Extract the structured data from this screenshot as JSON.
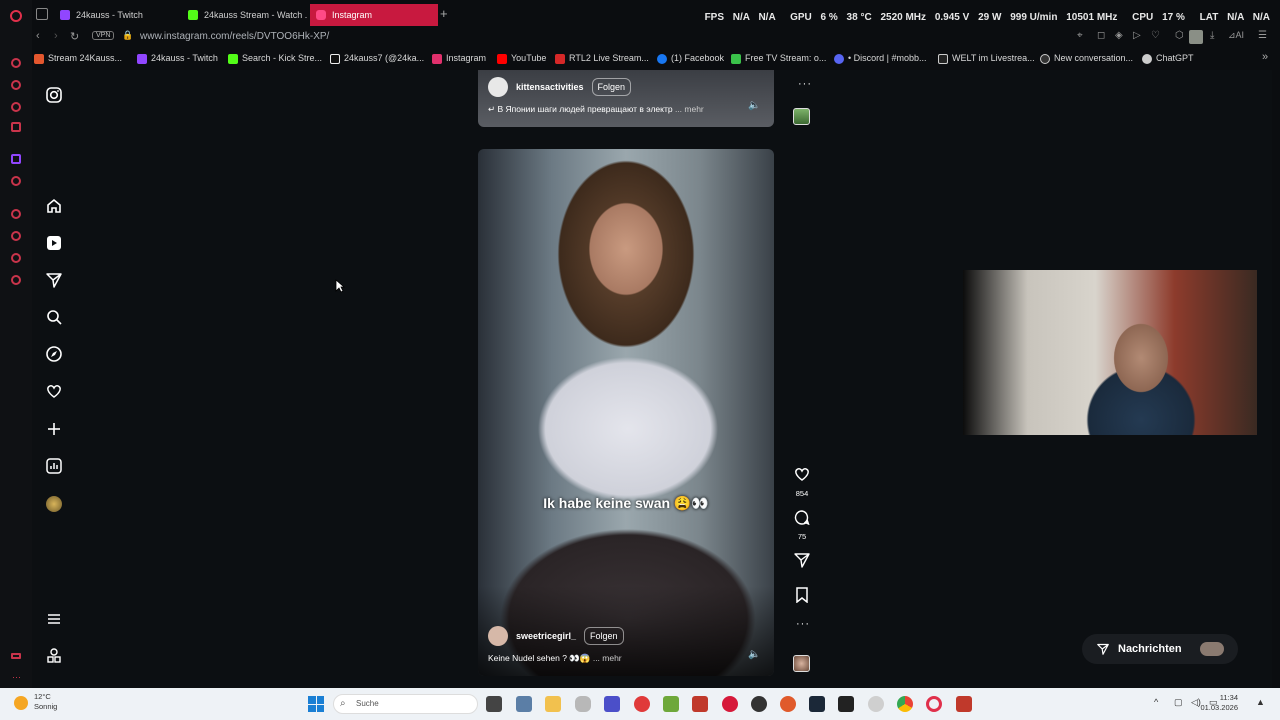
{
  "tabs": [
    {
      "label": "24kauss - Twitch",
      "active": false
    },
    {
      "label": "24kauss Stream - Watch ...",
      "active": false
    },
    {
      "label": "Instagram",
      "active": true
    }
  ],
  "stats": {
    "fps_label": "FPS",
    "fps_value": "N/A",
    "fps_value2": "N/A",
    "gpu_label": "GPU",
    "gpu_load": "6 %",
    "gpu_temp": "38 °C",
    "gpu_clock": "2520 MHz",
    "gpu_volt": "0.945 V",
    "gpu_power": "29 W",
    "gpu_fan": "999 U/min",
    "gpu_mem": "10501 MHz",
    "cpu_label": "CPU",
    "cpu_load": "17 %",
    "lat_label": "LAT",
    "lat_value": "N/A",
    "lat_value2": "N/A"
  },
  "address": {
    "vpn": "VPN",
    "url": "www.instagram.com/reels/DVTOO6Hk-XP/"
  },
  "bookmarks": [
    "Stream 24Kauss...",
    "24kauss - Twitch",
    "Search - Kick Stre...",
    "24kauss7 (@24ka...",
    "Instagram",
    "YouTube",
    "RTL2 Live Stream...",
    "(1) Facebook",
    "Free TV Stream: o...",
    "• Discord | #mobb...",
    "WELT im Livestrea...",
    "New conversation...",
    "ChatGPT"
  ],
  "prev_reel": {
    "username": "kittensactivities",
    "follow": "Folgen",
    "description": "↵ В Японии шаги людей превращают в электр",
    "more": "... mehr"
  },
  "reel": {
    "caption_overlay": "Ik habe keine swan 😩👀",
    "username": "sweetricegirl_",
    "follow": "Folgen",
    "description": "Keine Nudel sehen ? 👀😱",
    "more": "... mehr",
    "likes": "854",
    "comments": "75"
  },
  "messages": {
    "label": "Nachrichten"
  },
  "taskbar": {
    "weather_temp": "12°C",
    "weather_desc": "Sonnig",
    "search_placeholder": "Suche",
    "time": "11:34",
    "date": "01.03.2026"
  }
}
